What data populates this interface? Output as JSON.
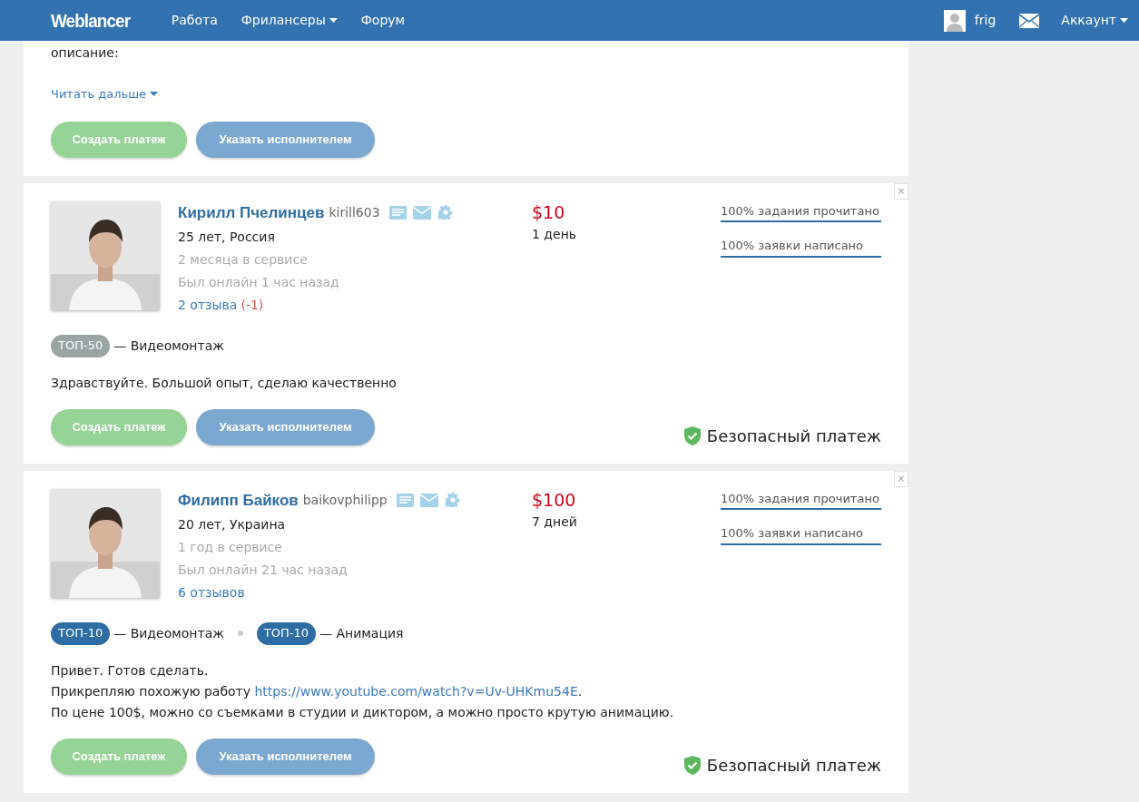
{
  "header": {
    "logo": "Weblancer",
    "nav": [
      {
        "label": "Работа",
        "dropdown": false
      },
      {
        "label": "Фрилансеры",
        "dropdown": true
      },
      {
        "label": "Форум",
        "dropdown": false
      }
    ],
    "user": "frig",
    "account": "Аккаунт"
  },
  "top_card": {
    "text": "описание:",
    "read_more": "Читать дальше",
    "buttons": [
      "Создать платеж",
      "Указать исполнителем"
    ]
  },
  "bids": [
    {
      "close": "×",
      "photo": {
        "kind": "picture"
      },
      "name": "Кирилл Пчелинцев",
      "username": "kirill603",
      "age_country": "25 лет, Россия",
      "service_time": "2 месяца в сервисе",
      "last_online": "Был онлайн 1 час назад",
      "reviews": "2 отзыва",
      "reviews_delta": "(-1)",
      "price": "$10",
      "term": "1 день",
      "stats": [
        "100% задания прочитано",
        "100% заявки написано"
      ],
      "tags": [
        {
          "badge": "ТОП-50",
          "category": "— Видеомонтаж",
          "color": "#9aa5a3"
        }
      ],
      "message": [
        {
          "text": "Здравствуйте. Большой опыт, сделаю качественно"
        }
      ],
      "buttons": [
        "Создать платеж",
        "Указать исполнителем"
      ],
      "safe_payment": "Безопасный платеж"
    },
    {
      "close": "×",
      "photo": {
        "kind": "picture"
      },
      "name": "Филипп Байков",
      "username": "baikovphilipp",
      "age_country": "20 лет, Украина",
      "service_time": "1 год в сервисе",
      "last_online": "Был онлайн 21 час назад",
      "reviews": "6 отзывов",
      "price": "$100",
      "term": "7 дней",
      "stats": [
        "100% задания прочитано",
        "100% заявки написано"
      ],
      "tags": [
        {
          "badge": "ТОП-10",
          "category": "— Видеомонтаж",
          "color": "#2e6da4"
        },
        {
          "badge": "ТОП-10",
          "category": "— Анимация",
          "color": "#2e6da4"
        }
      ],
      "message": [
        {
          "text": "Привет. Готов сделать."
        },
        {
          "text": "Прикрепляю похожую работу ",
          "link": "https://www.youtube.com/watch?v=Uv-UHKmu54E",
          "suffix": "."
        },
        {
          "text": "По цене 100$, можно со съемками в студии и диктором, а можно просто крутую анимацию."
        }
      ],
      "buttons": [
        "Создать платеж",
        "Указать исполнителем"
      ],
      "safe_payment": "Безопасный платеж"
    }
  ]
}
